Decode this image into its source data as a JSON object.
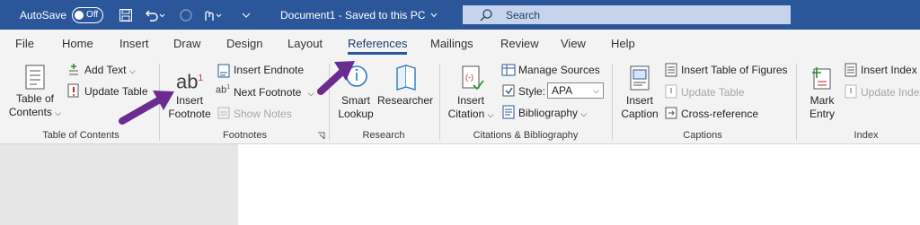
{
  "titlebar": {
    "autosave_label": "AutoSave",
    "autosave_state": "Off",
    "document_title": "Document1 - Saved to this PC",
    "search_placeholder": "Search"
  },
  "tabs": [
    {
      "label": "File"
    },
    {
      "label": "Home"
    },
    {
      "label": "Insert"
    },
    {
      "label": "Draw"
    },
    {
      "label": "Design"
    },
    {
      "label": "Layout"
    },
    {
      "label": "References",
      "active": true
    },
    {
      "label": "Mailings"
    },
    {
      "label": "Review"
    },
    {
      "label": "View"
    },
    {
      "label": "Help"
    }
  ],
  "ribbon": {
    "toc": {
      "btn_line1": "Table of",
      "btn_line2": "Contents",
      "add_text": "Add Text",
      "update_table": "Update Table",
      "group": "Table of Contents"
    },
    "footnotes": {
      "insert_line1": "Insert",
      "insert_line2": "Footnote",
      "insert_endnote": "Insert Endnote",
      "next_footnote": "Next Footnote",
      "show_notes": "Show Notes",
      "group": "Footnotes"
    },
    "research": {
      "smart_line1": "Smart",
      "smart_line2": "Lookup",
      "researcher": "Researcher",
      "group": "Research"
    },
    "citations": {
      "insert_line1": "Insert",
      "insert_line2": "Citation",
      "manage_sources": "Manage Sources",
      "style_label": "Style:",
      "style_value": "APA",
      "bibliography": "Bibliography",
      "group": "Citations & Bibliography"
    },
    "captions": {
      "insert_line1": "Insert",
      "insert_line2": "Caption",
      "insert_tof": "Insert Table of Figures",
      "update_table": "Update Table",
      "cross_ref": "Cross-reference",
      "group": "Captions"
    },
    "index": {
      "mark_line1": "Mark",
      "mark_line2": "Entry",
      "insert_index": "Insert Index",
      "update_index": "Update Index",
      "group": "Index"
    }
  },
  "annotation_color": "#6a2c91"
}
